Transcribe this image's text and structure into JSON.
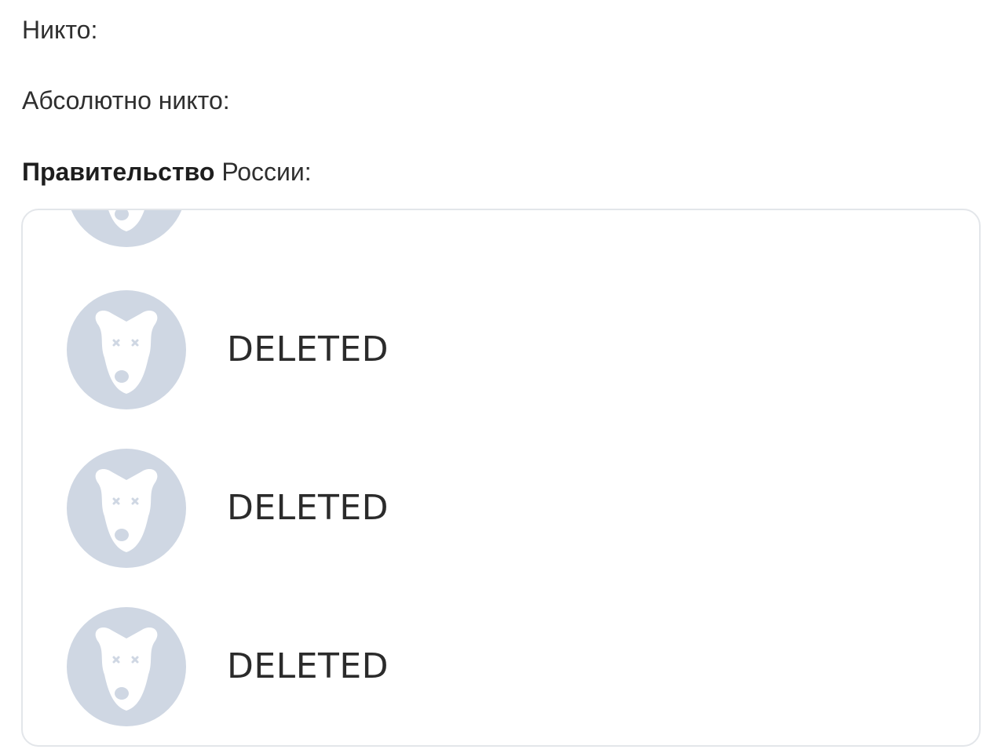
{
  "lines": {
    "nobody": "Никто:",
    "absolutely_nobody": "Абсолютно никто:",
    "government_bold": "Правительство",
    "government_rest": " России:"
  },
  "list": {
    "entries": [
      {
        "name": "DELETED",
        "avatar_icon": "deleted-dog-icon"
      },
      {
        "name": "DELETED",
        "avatar_icon": "deleted-dog-icon"
      },
      {
        "name": "DELETED",
        "avatar_icon": "deleted-dog-icon"
      }
    ]
  },
  "colors": {
    "avatar_bg": "#cfd7e3",
    "avatar_fg": "#ffffff",
    "panel_border": "#e3e6ea",
    "text": "#2b2b2b"
  }
}
